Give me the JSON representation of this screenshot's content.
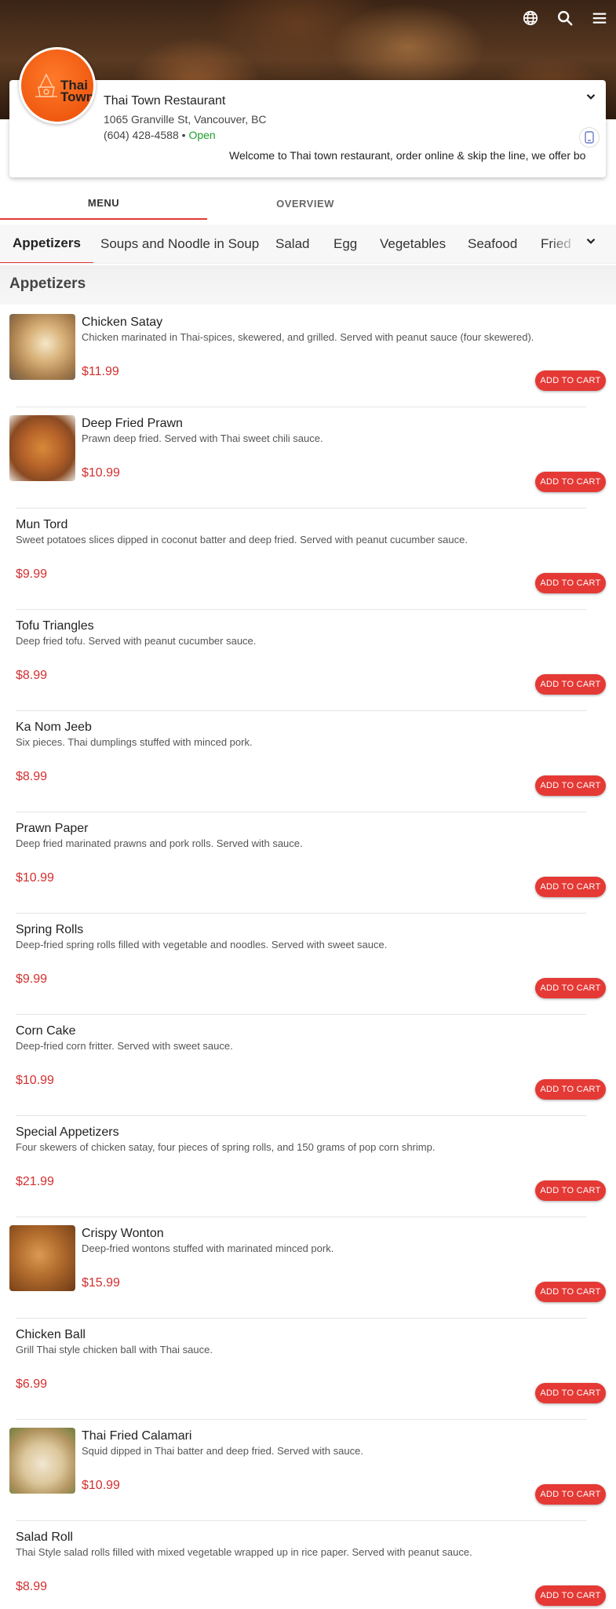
{
  "header": {
    "icons": [
      "globe-icon",
      "search-icon",
      "menu-icon"
    ]
  },
  "restaurant": {
    "logo_text_line1": "Thai",
    "logo_text_line2": "Town",
    "name": "Thai Town Restaurant",
    "address": "1065 Granville St, Vancouver, BC",
    "phone": "(604) 428-4588",
    "separator": " • ",
    "status": "Open",
    "welcome": "Welcome to Thai town restaurant, order online & skip the line, we offer bo"
  },
  "tabs": [
    {
      "label": "MENU",
      "active": true
    },
    {
      "label": "OVERVIEW",
      "active": false
    }
  ],
  "categories": [
    {
      "label": "Appetizers",
      "active": true
    },
    {
      "label": "Soups and Noodle in Soup"
    },
    {
      "label": "Salad"
    },
    {
      "label": "Egg"
    },
    {
      "label": "Vegetables"
    },
    {
      "label": "Seafood"
    },
    {
      "label": "Fried"
    }
  ],
  "section_title": "Appetizers",
  "add_label": "ADD TO CART",
  "items": [
    {
      "name": "Chicken Satay",
      "desc": "Chicken marinated in Thai-spices, skewered, and grilled. Served with peanut sauce (four skewered).",
      "price": "$11.99",
      "image": "satay"
    },
    {
      "name": "Deep Fried Prawn",
      "desc": "Prawn deep fried. Served with Thai sweet chili sauce.",
      "price": "$10.99",
      "image": "prawn"
    },
    {
      "name": "Mun Tord",
      "desc": "Sweet potatoes slices dipped in coconut batter and deep fried. Served with peanut cucumber sauce.",
      "price": "$9.99",
      "image": null
    },
    {
      "name": "Tofu Triangles",
      "desc": "Deep fried tofu. Served with peanut cucumber sauce.",
      "price": "$8.99",
      "image": null
    },
    {
      "name": "Ka Nom Jeeb",
      "desc": "Six pieces. Thai dumplings stuffed with minced pork.",
      "price": "$8.99",
      "image": null
    },
    {
      "name": "Prawn Paper",
      "desc": "Deep fried marinated prawns and pork rolls. Served with sauce.",
      "price": "$10.99",
      "image": null
    },
    {
      "name": "Spring Rolls",
      "desc": "Deep-fried spring rolls filled with vegetable and noodles. Served with sweet sauce.",
      "price": "$9.99",
      "image": null
    },
    {
      "name": "Corn Cake",
      "desc": "Deep-fried corn fritter. Served with sweet sauce.",
      "price": "$10.99",
      "image": null
    },
    {
      "name": "Special Appetizers",
      "desc": "Four skewers of chicken satay, four pieces of spring rolls, and 150 grams of pop corn shrimp.",
      "price": "$21.99",
      "image": null
    },
    {
      "name": "Crispy Wonton",
      "desc": "Deep-fried wontons stuffed with marinated minced pork.",
      "price": "$15.99",
      "image": "wonton"
    },
    {
      "name": "Chicken Ball",
      "desc": "Grill Thai style chicken ball with Thai sauce.",
      "price": "$6.99",
      "image": null
    },
    {
      "name": "Thai Fried Calamari",
      "desc": "Squid dipped in Thai batter and deep fried. Served with sauce.",
      "price": "$10.99",
      "image": "calamari"
    },
    {
      "name": "Salad Roll",
      "desc": "Thai Style salad rolls filled with mixed vegetable wrapped up in rice paper. Served with peanut sauce.",
      "price": "$8.99",
      "image": null
    }
  ],
  "colors": {
    "accent": "#e53935",
    "price": "#d32f2f",
    "open": "#1e9e2e"
  }
}
